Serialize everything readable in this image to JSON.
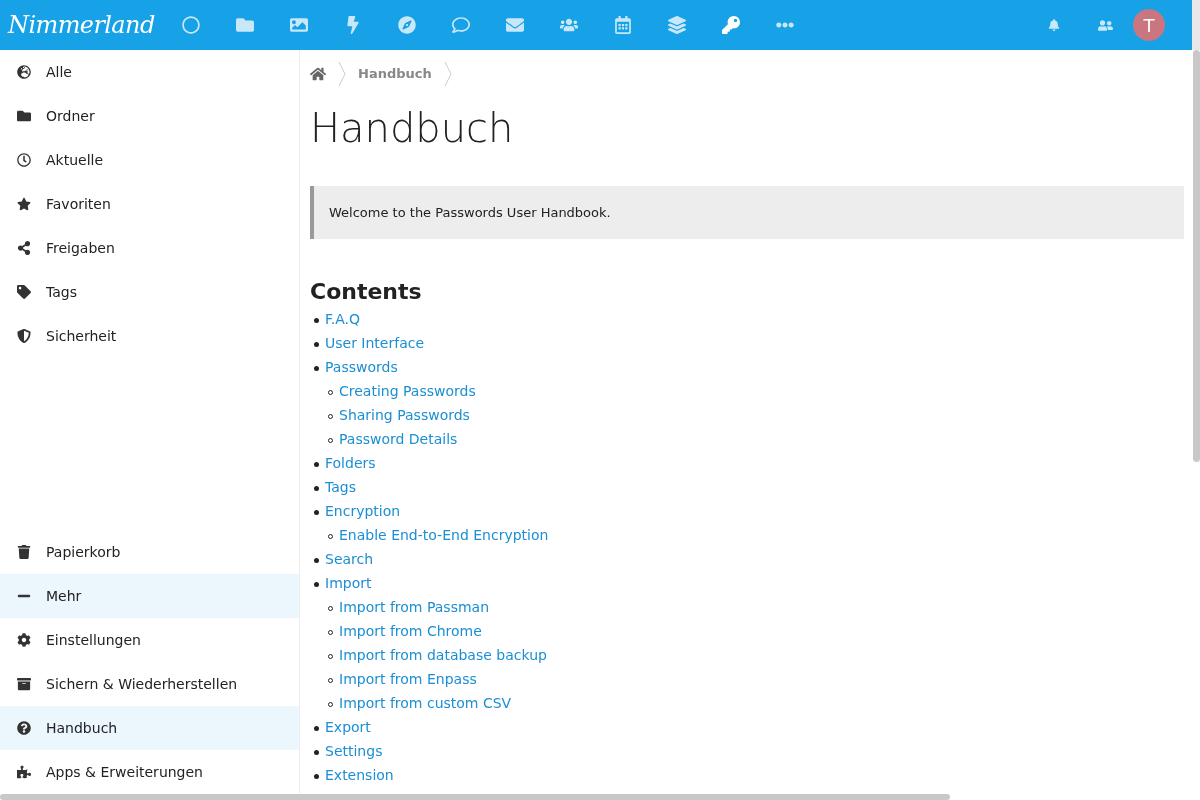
{
  "header": {
    "logo": "Nimmerland",
    "apps": [
      {
        "selected": false
      },
      {
        "selected": false
      },
      {
        "selected": false
      },
      {
        "selected": false
      },
      {
        "selected": false
      },
      {
        "selected": false
      },
      {
        "selected": false
      },
      {
        "selected": false
      },
      {
        "selected": false
      },
      {
        "selected": false
      },
      {
        "selected": true
      },
      {
        "selected": false
      }
    ],
    "avatar": {
      "initial": "T",
      "color": "#c97680"
    }
  },
  "sidebar": {
    "top_items": [
      {
        "label": "Alle",
        "highlighted": false
      },
      {
        "label": "Ordner",
        "highlighted": false
      },
      {
        "label": "Aktuelle",
        "highlighted": false
      },
      {
        "label": "Favoriten",
        "highlighted": false
      },
      {
        "label": "Freigaben",
        "highlighted": false
      },
      {
        "label": "Tags",
        "highlighted": false
      },
      {
        "label": "Sicherheit",
        "highlighted": false
      }
    ],
    "bottom_items": [
      {
        "label": "Papierkorb",
        "highlighted": false
      },
      {
        "label": "Mehr",
        "highlighted": true
      },
      {
        "label": "Einstellungen",
        "highlighted": false
      },
      {
        "label": "Sichern & Wiederherstellen",
        "highlighted": false
      },
      {
        "label": "Handbuch",
        "highlighted": true
      },
      {
        "label": "Apps & Erweiterungen",
        "highlighted": false
      }
    ]
  },
  "breadcrumb": [
    "Handbuch"
  ],
  "title": "Handbuch",
  "notice": "Welcome to the Passwords User Handbook.",
  "contents": {
    "heading": "Contents",
    "items": [
      {
        "label": "F.A.Q"
      },
      {
        "label": "User Interface"
      },
      {
        "label": "Passwords",
        "children": [
          {
            "label": "Creating Passwords"
          },
          {
            "label": "Sharing Passwords"
          },
          {
            "label": "Password Details"
          }
        ]
      },
      {
        "label": "Folders"
      },
      {
        "label": "Tags"
      },
      {
        "label": "Encryption",
        "children": [
          {
            "label": "Enable End-to-End Encryption"
          }
        ]
      },
      {
        "label": "Search"
      },
      {
        "label": "Import",
        "children": [
          {
            "label": "Import from Passman"
          },
          {
            "label": "Import from Chrome"
          },
          {
            "label": "Import from database backup"
          },
          {
            "label": "Import from Enpass"
          },
          {
            "label": "Import from custom CSV"
          }
        ]
      },
      {
        "label": "Export"
      },
      {
        "label": "Settings"
      },
      {
        "label": "Extension"
      }
    ]
  }
}
